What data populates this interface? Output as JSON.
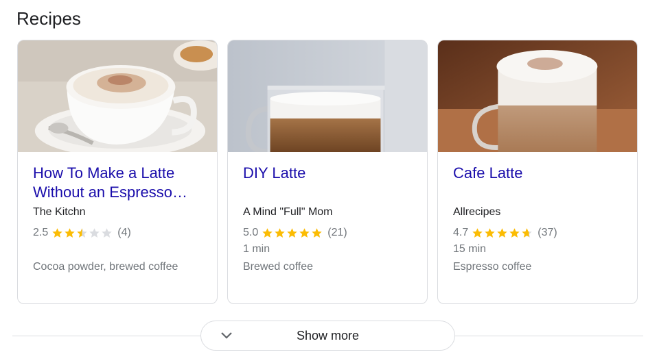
{
  "section_title": "Recipes",
  "cards": [
    {
      "title": "How To Make a Latte\nWithout an Espresso…",
      "source": "The Kitchn",
      "rating": "2.5",
      "stars": 2.5,
      "reviews": "(4)",
      "time": "",
      "ingredients": "Cocoa powder, brewed coffee",
      "image": "cappuccino-cup-photo"
    },
    {
      "title": "DIY Latte",
      "source": "A Mind \"Full\" Mom",
      "rating": "5.0",
      "stars": 5,
      "reviews": "(21)",
      "time": "1 min",
      "ingredients": "Brewed coffee",
      "image": "latte-glass-mug-photo"
    },
    {
      "title": "Cafe Latte",
      "source": "Allrecipes",
      "rating": "4.7",
      "stars": 4.7,
      "reviews": "(37)",
      "time": "15 min",
      "ingredients": "Espresso coffee",
      "image": "cafe-latte-mug-photo"
    }
  ],
  "show_more": {
    "label": "Show more",
    "icon": "chevron-down-icon"
  },
  "colors": {
    "link": "#1a0dab",
    "star": "#fbbc04",
    "star_empty": "#dadce0",
    "muted": "#70757a"
  }
}
